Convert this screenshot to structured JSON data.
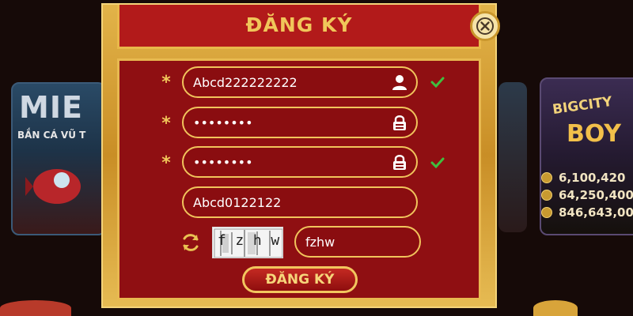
{
  "background": {
    "left_card": {
      "title": "MIE",
      "subtitle": "BẮN CÁ VŨ T"
    },
    "right_card": {
      "title_line1": "BIGCITY",
      "title_line2": "BOY"
    },
    "jackpots": [
      "6,100,420",
      "64,250,400",
      "846,643,00"
    ]
  },
  "dialog": {
    "title": "ĐĂNG KÝ",
    "close_icon": "close-icon",
    "fields": {
      "username": {
        "value": "Abcd222222222",
        "icon": "user-icon",
        "required": true,
        "valid": true
      },
      "password": {
        "value": "••••••••",
        "icon": "lock-icon",
        "required": true,
        "valid": false
      },
      "confirm_password": {
        "value": "••••••••",
        "icon": "lock-icon",
        "required": true,
        "valid": true
      },
      "referral": {
        "value": "Abcd0122122"
      },
      "captcha": {
        "image_text": [
          "f",
          "z",
          "h",
          "w"
        ],
        "value": "fzhw",
        "refresh_icon": "refresh-icon"
      }
    },
    "required_mark": "*",
    "submit_label": "ĐĂNG KÝ"
  },
  "colors": {
    "panel": "#8f0f12",
    "gold": "#f0c65a",
    "check": "#3fbf3f"
  }
}
